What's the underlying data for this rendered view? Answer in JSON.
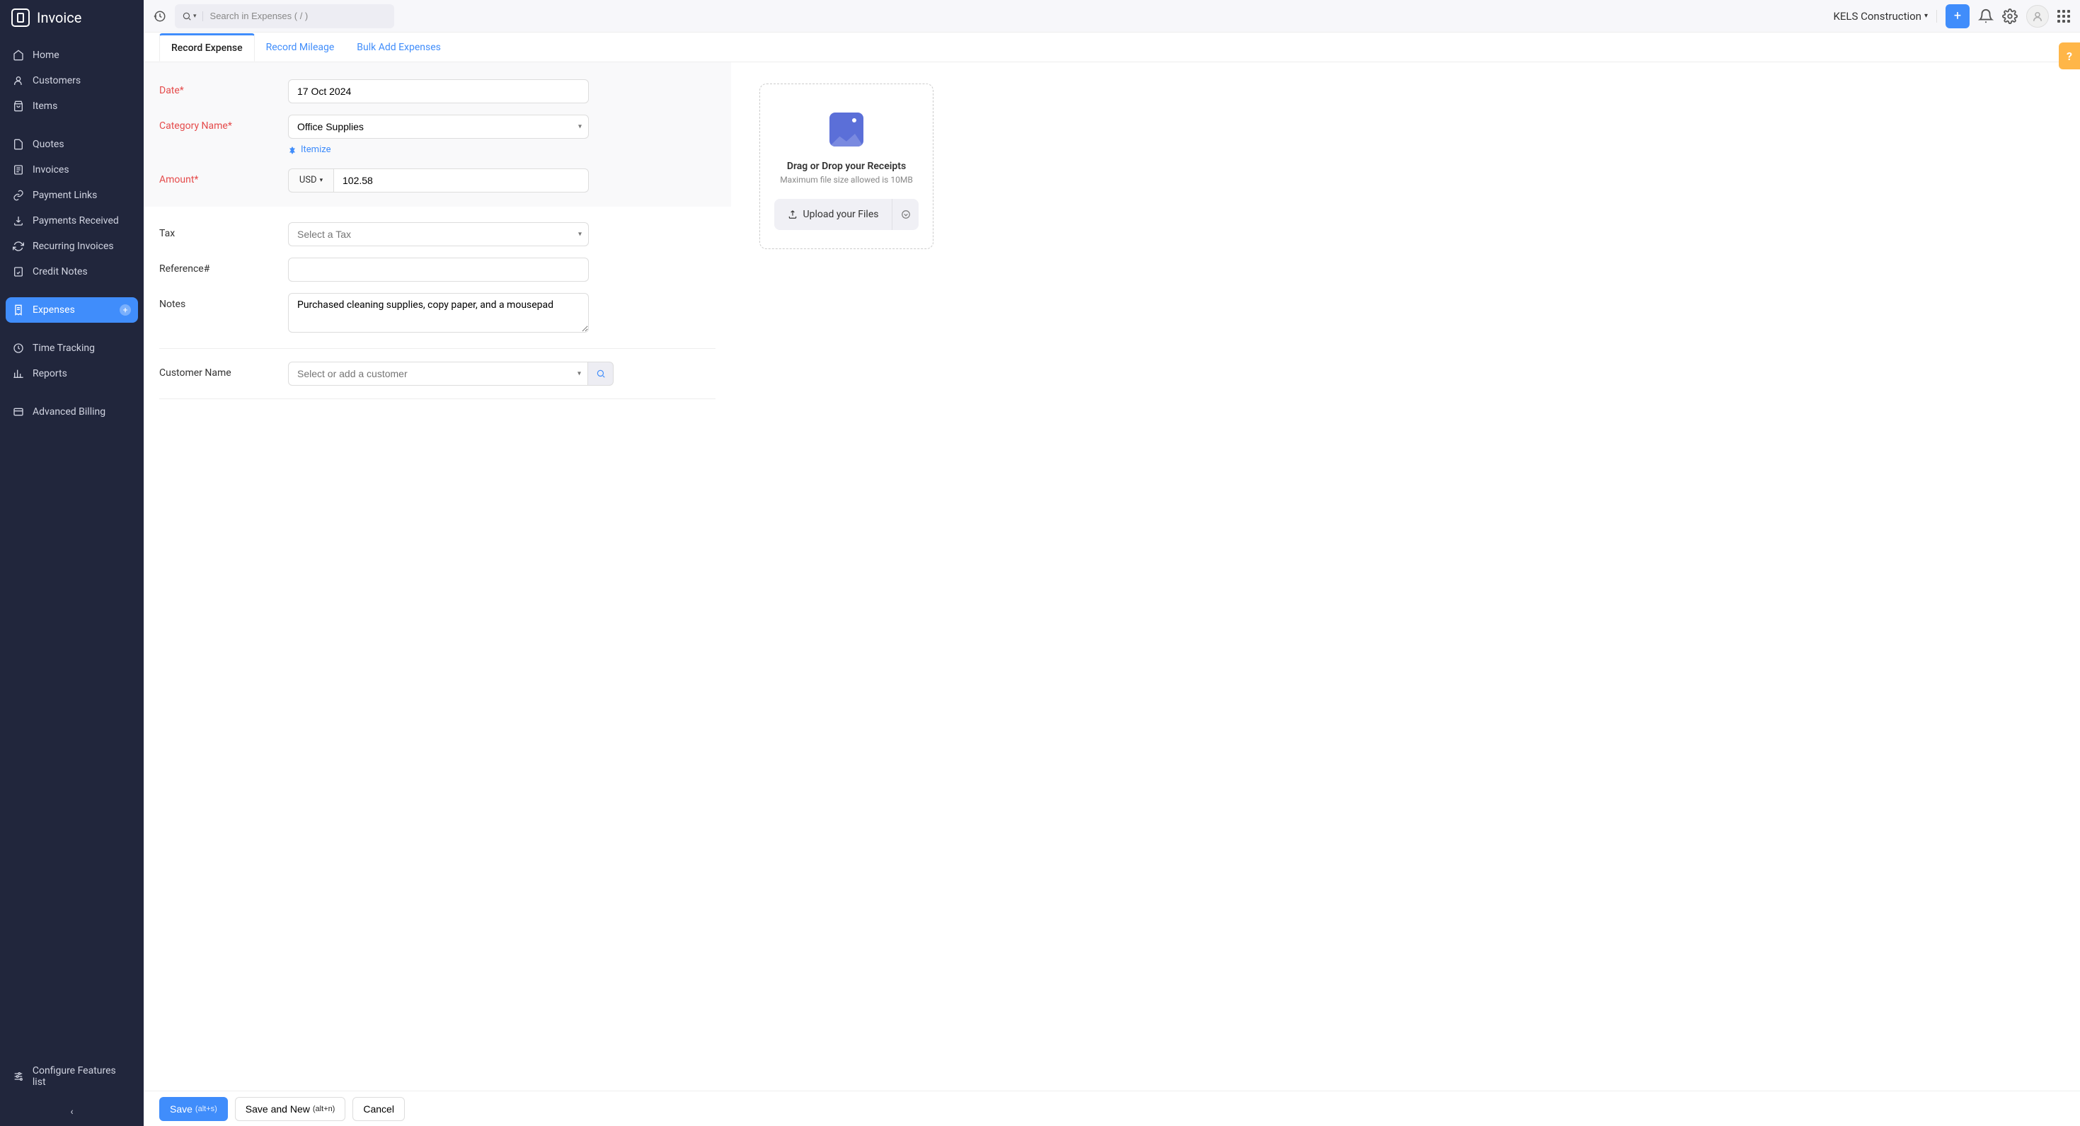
{
  "app_title": "Invoice",
  "sidebar": {
    "group1": [
      {
        "label": "Home",
        "icon": "home-icon"
      },
      {
        "label": "Customers",
        "icon": "user-icon"
      },
      {
        "label": "Items",
        "icon": "bag-icon"
      }
    ],
    "group2": [
      {
        "label": "Quotes",
        "icon": "file-icon"
      },
      {
        "label": "Invoices",
        "icon": "invoice-icon"
      },
      {
        "label": "Payment Links",
        "icon": "link-icon"
      },
      {
        "label": "Payments Received",
        "icon": "inbox-icon"
      },
      {
        "label": "Recurring Invoices",
        "icon": "refresh-icon"
      },
      {
        "label": "Credit Notes",
        "icon": "credit-icon"
      }
    ],
    "active": {
      "label": "Expenses",
      "icon": "receipt-icon"
    },
    "group3": [
      {
        "label": "Time Tracking",
        "icon": "clock-icon"
      },
      {
        "label": "Reports",
        "icon": "chart-icon"
      }
    ],
    "group4": [
      {
        "label": "Advanced Billing",
        "icon": "billing-icon"
      }
    ],
    "bottom": {
      "label": "Configure Features list",
      "icon": "settings-icon"
    }
  },
  "topbar": {
    "search_placeholder": "Search in Expenses ( / )",
    "org_name": "KELS Construction"
  },
  "tabs": [
    {
      "label": "Record Expense",
      "active": true
    },
    {
      "label": "Record Mileage",
      "active": false
    },
    {
      "label": "Bulk Add Expenses",
      "active": false
    }
  ],
  "form": {
    "date_label": "Date*",
    "date_value": "17 Oct 2024",
    "category_label": "Category Name*",
    "category_value": "Office Supplies",
    "itemize_label": "Itemize",
    "amount_label": "Amount*",
    "currency": "USD",
    "amount_value": "102.58",
    "tax_label": "Tax",
    "tax_placeholder": "Select a Tax",
    "reference_label": "Reference#",
    "reference_value": "",
    "notes_label": "Notes",
    "notes_value": "Purchased cleaning supplies, copy paper, and a mousepad",
    "customer_label": "Customer Name",
    "customer_placeholder": "Select or add a customer"
  },
  "upload": {
    "title": "Drag or Drop your Receipts",
    "subtitle": "Maximum file size allowed is 10MB",
    "button_label": "Upload your Files"
  },
  "footer": {
    "save_label": "Save",
    "save_shortcut": "(alt+s)",
    "save_new_label": "Save and New",
    "save_new_shortcut": "(alt+n)",
    "cancel_label": "Cancel"
  },
  "help_label": "?"
}
